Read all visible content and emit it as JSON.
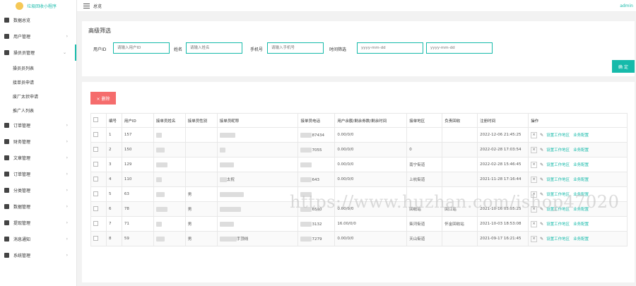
{
  "app": {
    "logo_text": "垃圾回收小程序"
  },
  "header": {
    "title": "总览",
    "user": "admin"
  },
  "sidebar": {
    "items": [
      {
        "label": "数据总览",
        "icon": "home-icon",
        "chevron": false
      },
      {
        "label": "用户管理",
        "icon": "user-icon",
        "chevron": true
      },
      {
        "label": "操员员管理",
        "icon": "truck-icon",
        "chevron": true,
        "active": true,
        "children": [
          "操员员列表",
          "接单员申请",
          "废厂太状申请",
          "推广人列表"
        ]
      },
      {
        "label": "订单管理",
        "icon": "order-icon",
        "chevron": true
      },
      {
        "label": "财务管理",
        "icon": "wallet-icon",
        "chevron": true
      },
      {
        "label": "文章管理",
        "icon": "article-icon",
        "chevron": true
      },
      {
        "label": "订单管理",
        "icon": "cart-icon",
        "chevron": true
      },
      {
        "label": "分类管理",
        "icon": "list-icon",
        "chevron": true
      },
      {
        "label": "数据管理",
        "icon": "data-icon",
        "chevron": true
      },
      {
        "label": "提现管理",
        "icon": "withdraw-icon",
        "chevron": true
      },
      {
        "label": "消息通知",
        "icon": "message-icon",
        "chevron": true
      },
      {
        "label": "系统管理",
        "icon": "gear-icon",
        "chevron": true
      }
    ]
  },
  "filter": {
    "title": "高级筛选",
    "fields": [
      {
        "label": "用户ID",
        "placeholder": "请输入用户ID"
      },
      {
        "label": "姓名",
        "placeholder": "请输入姓名"
      },
      {
        "label": "手机号",
        "placeholder": "请输入手机号"
      },
      {
        "label": "时间筛选",
        "placeholder": "yyyy-mm-dd",
        "placeholder2": "yyyy-mm-dd"
      }
    ],
    "confirm_label": "确 定"
  },
  "table": {
    "delete_label": "× 删除",
    "headers": [
      "编号",
      "用户ID",
      "接单员姓名",
      "接单员性别",
      "接单员昵称",
      "接单员电话",
      "用户余额/剩余券数/剩余时间",
      "接单地区",
      "负责回收",
      "注册时间",
      "操作"
    ],
    "rows": [
      {
        "no": "1",
        "uid": "157",
        "gender": "",
        "nick_suffix": "",
        "phone_suffix": "87434",
        "balance": "0.00/0/0",
        "region": "",
        "recycle": "",
        "time": "2022-12-06 21:45:25"
      },
      {
        "no": "2",
        "uid": "150",
        "gender": "",
        "nick_suffix": "",
        "phone_suffix": "7055",
        "balance": "0.00/0/0",
        "region": "0",
        "recycle": "",
        "time": "2022-02-28 17:03:54"
      },
      {
        "no": "3",
        "uid": "129",
        "gender": "",
        "nick_suffix": "",
        "phone_suffix": "",
        "balance": "0.00/0/0",
        "region": "南宁街道",
        "recycle": "",
        "time": "2022-02-28 15:46:45"
      },
      {
        "no": "4",
        "uid": "110",
        "gender": "",
        "nick_suffix": "太祝",
        "phone_suffix": "643",
        "balance": "0.00/0/0",
        "region": "上杭街道",
        "recycle": "",
        "time": "2021-11-28 17:16:44"
      },
      {
        "no": "5",
        "uid": "63",
        "gender": "男",
        "nick_suffix": "",
        "phone_suffix": "",
        "balance": "",
        "region": "",
        "recycle": "",
        "time": ""
      },
      {
        "no": "6",
        "uid": "78",
        "gender": "男",
        "nick_suffix": "",
        "phone_suffix": "6540",
        "balance": "0.00/0/0",
        "region": "回收站",
        "recycle": "回江站",
        "time": "2021-10-16 05:55:25"
      },
      {
        "no": "7",
        "uid": "71",
        "gender": "男",
        "nick_suffix": "",
        "phone_suffix": "3132",
        "balance": "16.00/0/0",
        "region": "柴河街道",
        "recycle": "怀金回收站",
        "time": "2021-10-03 18:53:08"
      },
      {
        "no": "8",
        "uid": "59",
        "gender": "男",
        "nick_suffix": "手顶线",
        "phone_suffix": "7279",
        "balance": "0.00/0/0",
        "region": "天山街道",
        "recycle": "",
        "time": "2021-09-17 16:21:45"
      }
    ],
    "op_links": [
      "设置工作地区",
      "业务配置"
    ]
  },
  "watermark": "https://www.huzhan.com/ishop47020",
  "colors": {
    "accent": "#16baaa",
    "danger": "#f56c6c"
  }
}
